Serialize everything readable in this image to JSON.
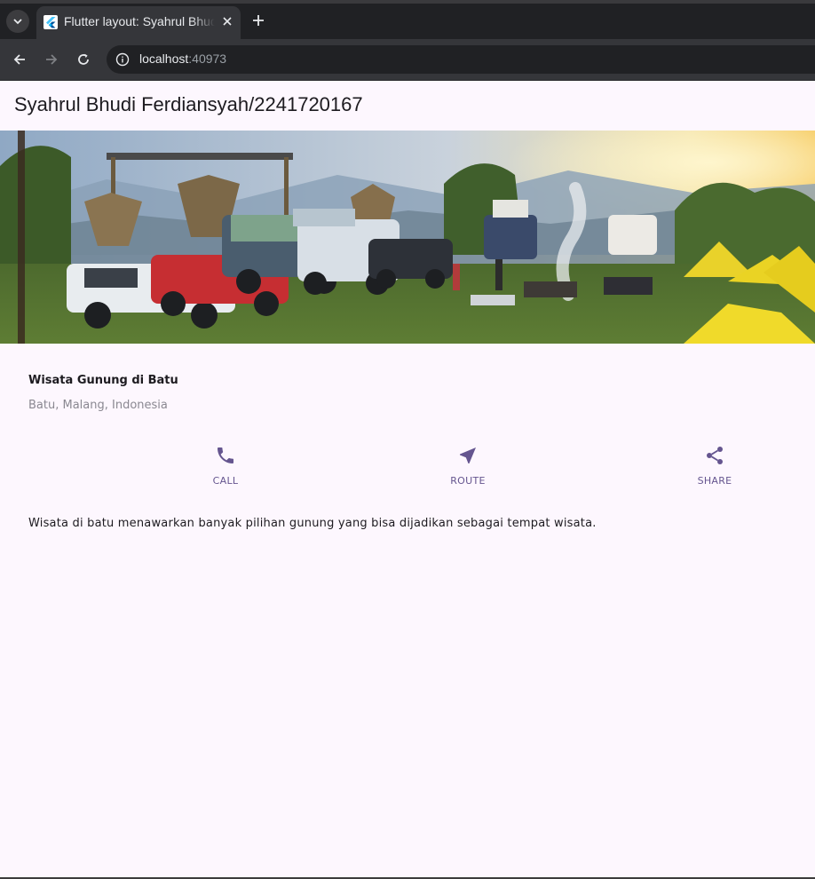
{
  "browser": {
    "tab_title": "Flutter layout: Syahrul Bhudi Ferdiansyah/2241720167",
    "url_host": "localhost",
    "url_port": ":40973"
  },
  "app": {
    "title": "Syahrul Bhudi Ferdiansyah/2241720167",
    "place_name": "Wisata Gunung di Batu",
    "place_location": "Batu, Malang, Indonesia",
    "buttons": [
      {
        "label": "CALL",
        "icon": "phone-icon"
      },
      {
        "label": "ROUTE",
        "icon": "near-me-icon"
      },
      {
        "label": "SHARE",
        "icon": "share-icon"
      }
    ],
    "description": "Wisata di batu menawarkan banyak pilihan gunung yang bisa dijadikan sebagai tempat wisata.",
    "accent_color": "#65558f",
    "background_color": "#fdf7fe"
  }
}
